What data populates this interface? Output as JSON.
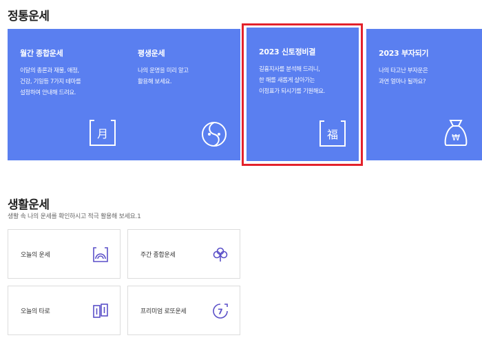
{
  "section_fortune": {
    "title": "정통운세",
    "cards": [
      {
        "title": "월간 종합운세",
        "lines": [
          "이달의 총론과 재물, 애정,",
          "건강, 기일등 7가지 테마를",
          "설정하여 안내해 드려요."
        ],
        "icon": "calendar-moon-icon",
        "glyph": "月"
      },
      {
        "title": "평생운세",
        "lines": [
          "나의 운명을 미리 알고",
          "활용해 보세요."
        ],
        "icon": "yin-yang-face-icon"
      },
      {
        "title": "2023 신토정비결",
        "lines": [
          "길흉지사를 분석해 드리니,",
          "한 해를 새롭게 살아가는",
          "이정표가 되시기를 기원해요."
        ],
        "icon": "fortune-blessing-icon",
        "glyph": "福"
      },
      {
        "title": "2023 부자되기",
        "lines": [
          "나의 타고난 부자운은",
          "과연 얼마나 될까요?"
        ],
        "icon": "money-bag-icon",
        "glyph": "₩"
      }
    ]
  },
  "section_life": {
    "title": "생활운세",
    "description": "생활 속 나의 운세를 확인하시고 적극 활용해 보세요.1",
    "tiles": [
      {
        "label": "오늘의 운세",
        "icon": "sunrise-frame-icon"
      },
      {
        "label": "주간 종합운세",
        "icon": "clover-icon"
      },
      {
        "label": "오늘의 타로",
        "icon": "tarot-cards-icon"
      },
      {
        "label": "프리미엄 로또운세",
        "icon": "lotto-seven-icon",
        "glyph": "7"
      }
    ]
  },
  "colors": {
    "card_bg": "#5a7ff0",
    "highlight": "#e3212b",
    "icon_accent": "#5a4fc8"
  }
}
